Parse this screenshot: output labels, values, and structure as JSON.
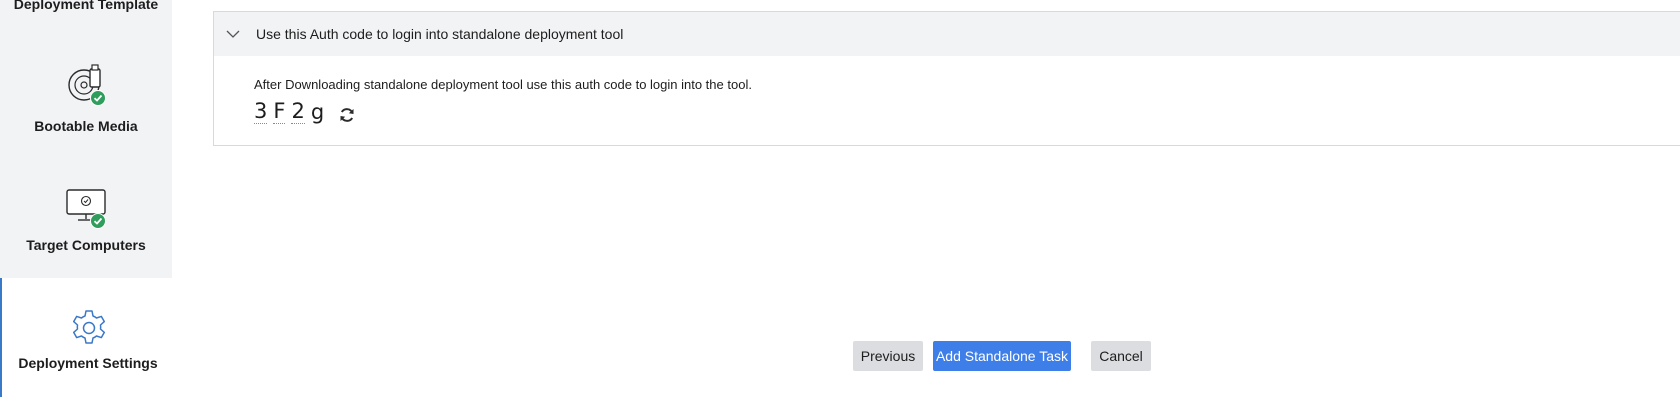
{
  "sidebar": {
    "steps": [
      {
        "label": "Deployment Template",
        "icon": "template-icon",
        "status": "complete"
      },
      {
        "label": "Bootable Media",
        "icon": "bootable-media-icon",
        "status": "complete"
      },
      {
        "label": "Target Computers",
        "icon": "monitor-icon",
        "status": "complete"
      },
      {
        "label": "Deployment Settings",
        "icon": "gear-icon",
        "status": "active"
      }
    ]
  },
  "auth_panel": {
    "title": "Use this Auth code to login into standalone deployment tool",
    "description": "After Downloading standalone deployment tool use this auth code to login into the tool.",
    "code_chars": [
      "3",
      "F",
      "2",
      "g"
    ]
  },
  "footer": {
    "previous_label": "Previous",
    "add_label": "Add Standalone Task",
    "cancel_label": "Cancel"
  },
  "colors": {
    "accent": "#3d7ee8",
    "check": "#2f9e5c",
    "active_border": "#3a78c8",
    "sidebar_bg": "#f2f3f5"
  }
}
